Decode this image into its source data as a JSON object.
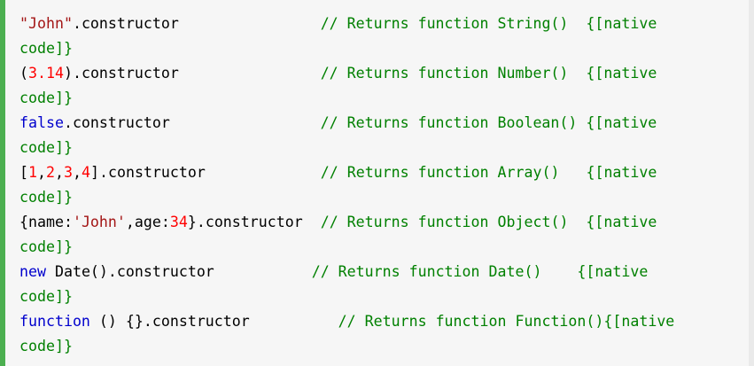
{
  "colors": {
    "accent_bar": "#4caf50",
    "background": "#f6f6f6",
    "string": "#a31515",
    "number": "#ff0000",
    "keyword": "#0000cd",
    "comment": "#008000",
    "text": "#000000"
  },
  "code_lines": [
    {
      "parts": [
        {
          "t": "str",
          "v": "\"John\""
        },
        {
          "t": "plain",
          "v": ".constructor                "
        },
        {
          "t": "cmt",
          "v": "// Returns function String()  {[native"
        }
      ],
      "wrap": "code]}"
    },
    {
      "parts": [
        {
          "t": "plain",
          "v": "("
        },
        {
          "t": "num",
          "v": "3.14"
        },
        {
          "t": "plain",
          "v": ").constructor                "
        },
        {
          "t": "cmt",
          "v": "// Returns function Number()  {[native"
        }
      ],
      "wrap": "code]}"
    },
    {
      "parts": [
        {
          "t": "kw",
          "v": "false"
        },
        {
          "t": "plain",
          "v": ".constructor                 "
        },
        {
          "t": "cmt",
          "v": "// Returns function Boolean() {[native"
        }
      ],
      "wrap": "code]}"
    },
    {
      "parts": [
        {
          "t": "plain",
          "v": "["
        },
        {
          "t": "num",
          "v": "1"
        },
        {
          "t": "plain",
          "v": ","
        },
        {
          "t": "num",
          "v": "2"
        },
        {
          "t": "plain",
          "v": ","
        },
        {
          "t": "num",
          "v": "3"
        },
        {
          "t": "plain",
          "v": ","
        },
        {
          "t": "num",
          "v": "4"
        },
        {
          "t": "plain",
          "v": "].constructor             "
        },
        {
          "t": "cmt",
          "v": "// Returns function Array()   {[native"
        }
      ],
      "wrap": "code]}"
    },
    {
      "parts": [
        {
          "t": "plain",
          "v": "{name:"
        },
        {
          "t": "str",
          "v": "'John'"
        },
        {
          "t": "plain",
          "v": ",age:"
        },
        {
          "t": "num",
          "v": "34"
        },
        {
          "t": "plain",
          "v": "}.constructor  "
        },
        {
          "t": "cmt",
          "v": "// Returns function Object()  {[native"
        }
      ],
      "wrap": "code]}"
    },
    {
      "parts": [
        {
          "t": "kw",
          "v": "new"
        },
        {
          "t": "plain",
          "v": " Date().constructor           "
        },
        {
          "t": "cmt",
          "v": "// Returns function Date()    {[native"
        }
      ],
      "wrap": "code]}"
    },
    {
      "parts": [
        {
          "t": "kw",
          "v": "function"
        },
        {
          "t": "plain",
          "v": " () {}.constructor          "
        },
        {
          "t": "cmt",
          "v": "// Returns function Function(){[native"
        }
      ],
      "wrap": "code]}"
    }
  ]
}
